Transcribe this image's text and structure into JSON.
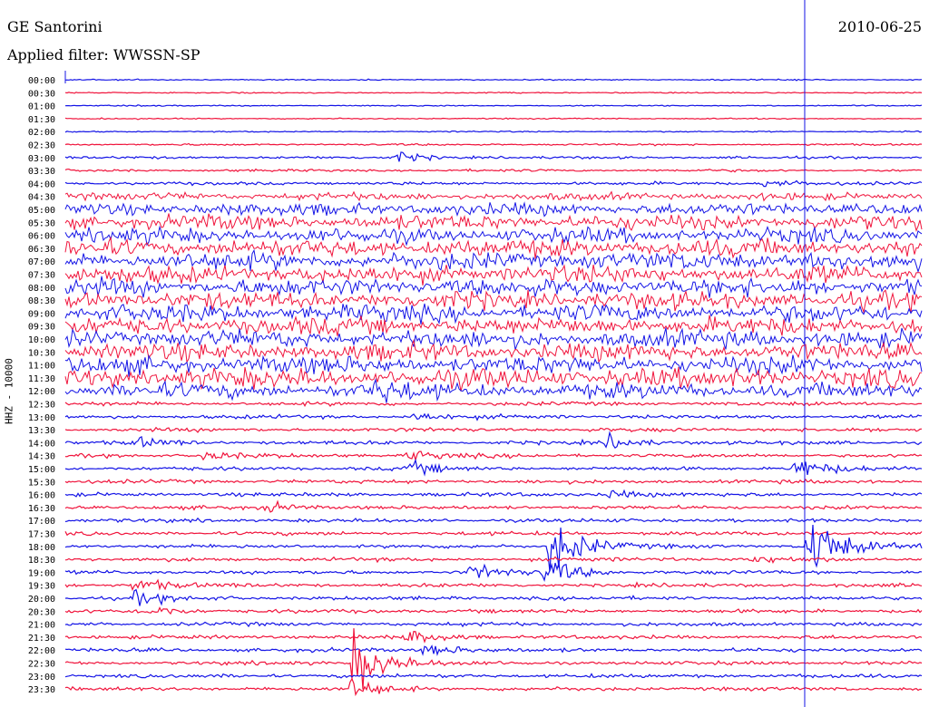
{
  "header": {
    "station": "GE Santorini",
    "date": "2010-06-25",
    "filter": "Applied filter: WWSSN-SP"
  },
  "channel_label": "HHZ - 10000",
  "colors": {
    "even_row": "#1414e6",
    "odd_row": "#f0143c",
    "marker": "#1414e6"
  },
  "chart_data": {
    "type": "line",
    "title": "GE Santorini",
    "subtitle": "Applied filter: WWSSN-SP",
    "ylabel": "HHZ - 10000",
    "y_tick_labels": [
      "00:00",
      "00:30",
      "01:00",
      "01:30",
      "02:00",
      "02:30",
      "03:00",
      "03:30",
      "04:00",
      "04:30",
      "05:00",
      "05:30",
      "06:00",
      "06:30",
      "07:00",
      "07:30",
      "08:00",
      "08:30",
      "09:00",
      "09:30",
      "10:00",
      "10:30",
      "11:00",
      "11:30",
      "12:00",
      "12:30",
      "13:00",
      "13:30",
      "14:00",
      "14:30",
      "15:00",
      "15:30",
      "16:00",
      "16:30",
      "17:00",
      "17:30",
      "18:00",
      "18:30",
      "19:00",
      "19:30",
      "20:00",
      "20:30",
      "21:00",
      "21:30",
      "22:00",
      "22:30",
      "23:00",
      "23:30"
    ],
    "x_range_minutes": [
      0,
      30
    ],
    "noise_amplitude_per_row": [
      1,
      1,
      1,
      1,
      1,
      1.5,
      2,
      2,
      2.5,
      6,
      10,
      12,
      12,
      14,
      14,
      14,
      14,
      14,
      14,
      14,
      14,
      14,
      14,
      16,
      12,
      3,
      3,
      3,
      3,
      3,
      3,
      3,
      3,
      3,
      3,
      3,
      3,
      3,
      3,
      3,
      3,
      3,
      3,
      3,
      3,
      3,
      3,
      3
    ],
    "events": [
      {
        "row": 6,
        "minute": 11.6,
        "amplitude": 10
      },
      {
        "row": 8,
        "minute": 24.4,
        "amplitude": 8
      },
      {
        "row": 24,
        "minute": 10.8,
        "amplitude": 18
      },
      {
        "row": 26,
        "minute": 12.2,
        "amplitude": 8
      },
      {
        "row": 28,
        "minute": 2.4,
        "amplitude": 10
      },
      {
        "row": 28,
        "minute": 19.0,
        "amplitude": 14
      },
      {
        "row": 29,
        "minute": 12.0,
        "amplitude": 10
      },
      {
        "row": 29,
        "minute": 4.8,
        "amplitude": 8
      },
      {
        "row": 30,
        "minute": 12.0,
        "amplitude": 12
      },
      {
        "row": 30,
        "minute": 25.5,
        "amplitude": 22
      },
      {
        "row": 32,
        "minute": 19.0,
        "amplitude": 9
      },
      {
        "row": 33,
        "minute": 7.0,
        "amplitude": 9
      },
      {
        "row": 36,
        "minute": 17.0,
        "amplitude": 60
      },
      {
        "row": 36,
        "minute": 26.0,
        "amplitude": 70
      },
      {
        "row": 37,
        "minute": 24.0,
        "amplitude": 8
      },
      {
        "row": 38,
        "minute": 14.2,
        "amplitude": 16
      },
      {
        "row": 38,
        "minute": 16.8,
        "amplitude": 28
      },
      {
        "row": 39,
        "minute": 2.4,
        "amplitude": 16
      },
      {
        "row": 40,
        "minute": 2.4,
        "amplitude": 12
      },
      {
        "row": 41,
        "minute": 2.8,
        "amplitude": 12
      },
      {
        "row": 43,
        "minute": 12.0,
        "amplitude": 14
      },
      {
        "row": 44,
        "minute": 12.6,
        "amplitude": 14
      },
      {
        "row": 45,
        "minute": 10.1,
        "amplitude": 60
      },
      {
        "row": 47,
        "minute": 10.0,
        "amplitude": 20
      }
    ],
    "marker_line_minute": 25.9,
    "grid": false
  }
}
